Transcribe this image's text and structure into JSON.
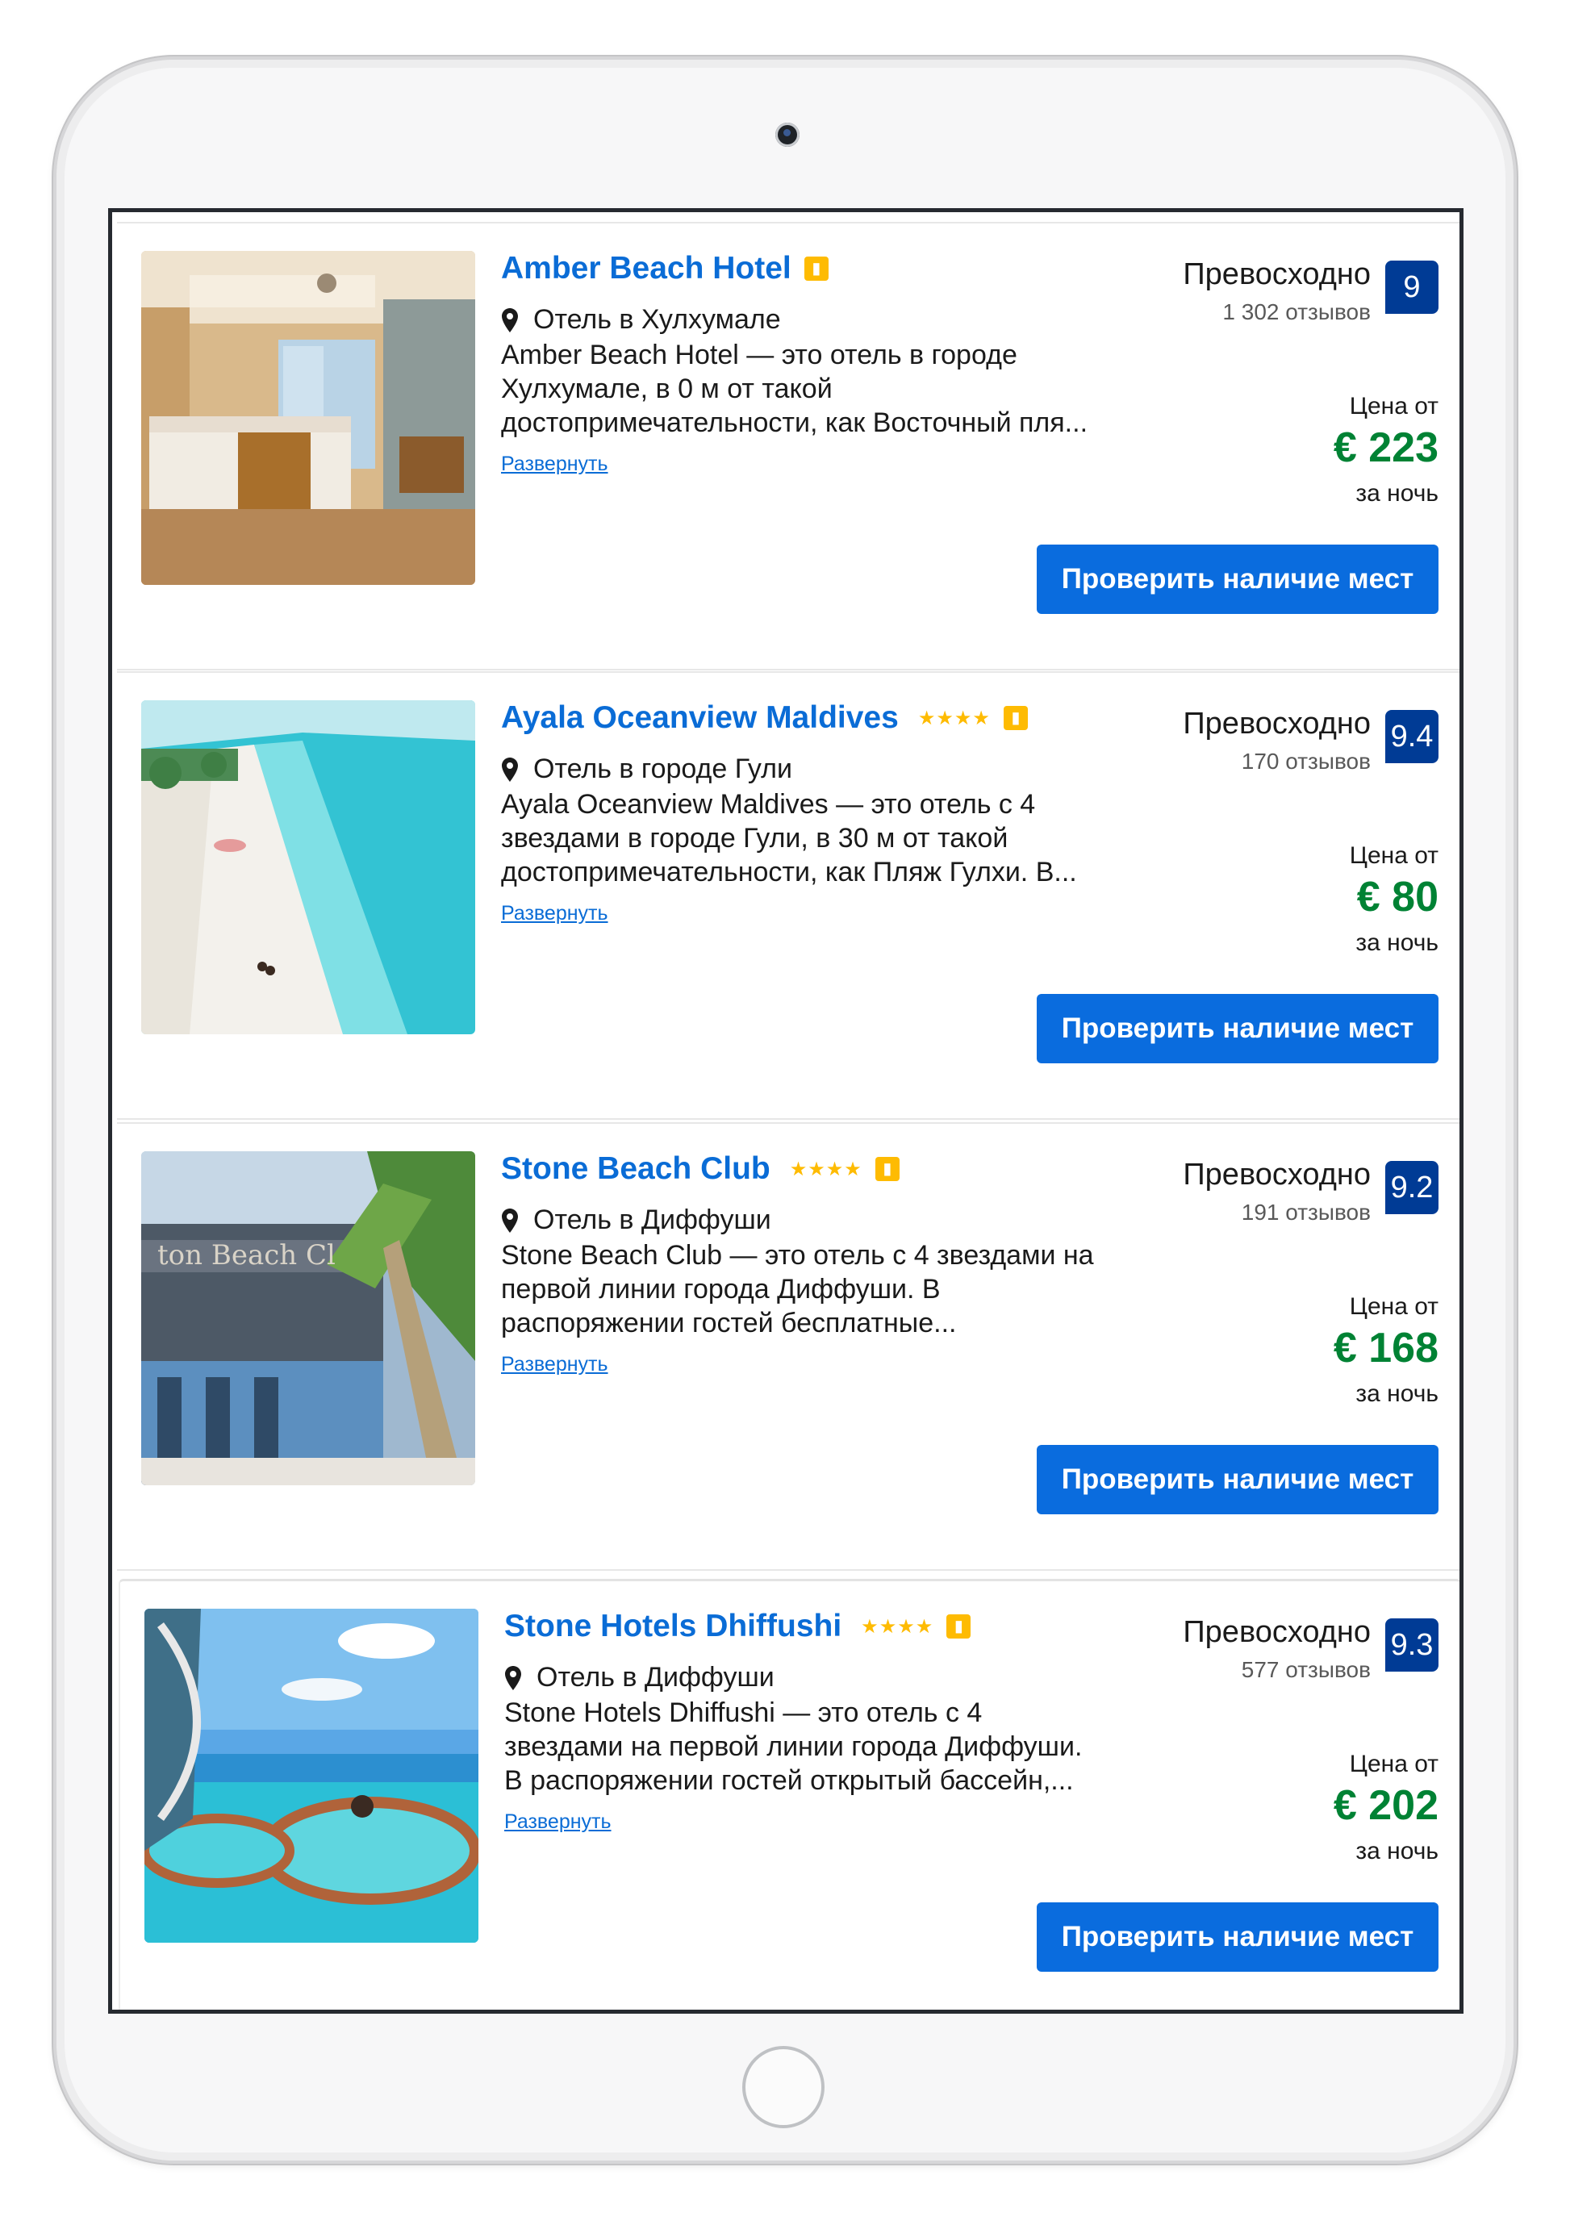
{
  "ui": {
    "expand_label": "Развернуть",
    "price_from_label": "Цена от",
    "per_night_label": "за ночь",
    "check_button_label": "Проверить наличие мест",
    "preferred_badge": "👍"
  },
  "hotels": [
    {
      "name": "Amber Beach Hotel",
      "stars": "",
      "location": "Отель в Хулхумале",
      "desc_lines": [
        "Amber Beach Hotel — это отель в городе",
        "Хулхумале, в 0 м от такой",
        "достопримечательности, как Восточный пля..."
      ],
      "rating_word": "Превосходно",
      "reviews": "1 302 отзывов",
      "score": "9",
      "price": "€ 223"
    },
    {
      "name": "Ayala Oceanview Maldives",
      "stars": "★★★★",
      "location": "Отель в городе Гули",
      "desc_lines": [
        "Ayala Oceanview Maldives — это отель с 4",
        "звездами в городе Гули, в 30 м от такой",
        "достопримечательности, как Пляж Гулхи. В..."
      ],
      "rating_word": "Превосходно",
      "reviews": "170 отзывов",
      "score": "9.4",
      "price": "€ 80"
    },
    {
      "name": "Stone Beach Club",
      "stars": "★★★★",
      "location": "Отель в Диффуши",
      "desc_lines": [
        "Stone Beach Club — это отель с 4 звездами на",
        "первой линии города Диффуши. В",
        "распоряжении гостей бесплатные..."
      ],
      "rating_word": "Превосходно",
      "reviews": "191 отзывов",
      "score": "9.2",
      "price": "€ 168"
    },
    {
      "name": "Stone Hotels Dhiffushi",
      "stars": "★★★★",
      "location": "Отель в Диффуши",
      "desc_lines": [
        "Stone Hotels Dhiffushi — это отель с 4",
        "звездами на первой линии города Диффуши.",
        "В распоряжении гостей открытый бассейн,..."
      ],
      "rating_word": "Превосходно",
      "reviews": "577 отзывов",
      "score": "9.3",
      "price": "€ 202"
    }
  ],
  "colors": {
    "link_blue": "#0a6cd6",
    "score_navy": "#003b95",
    "price_green": "#008234",
    "star_yellow": "#febb02",
    "button_blue": "#0a6cde"
  }
}
